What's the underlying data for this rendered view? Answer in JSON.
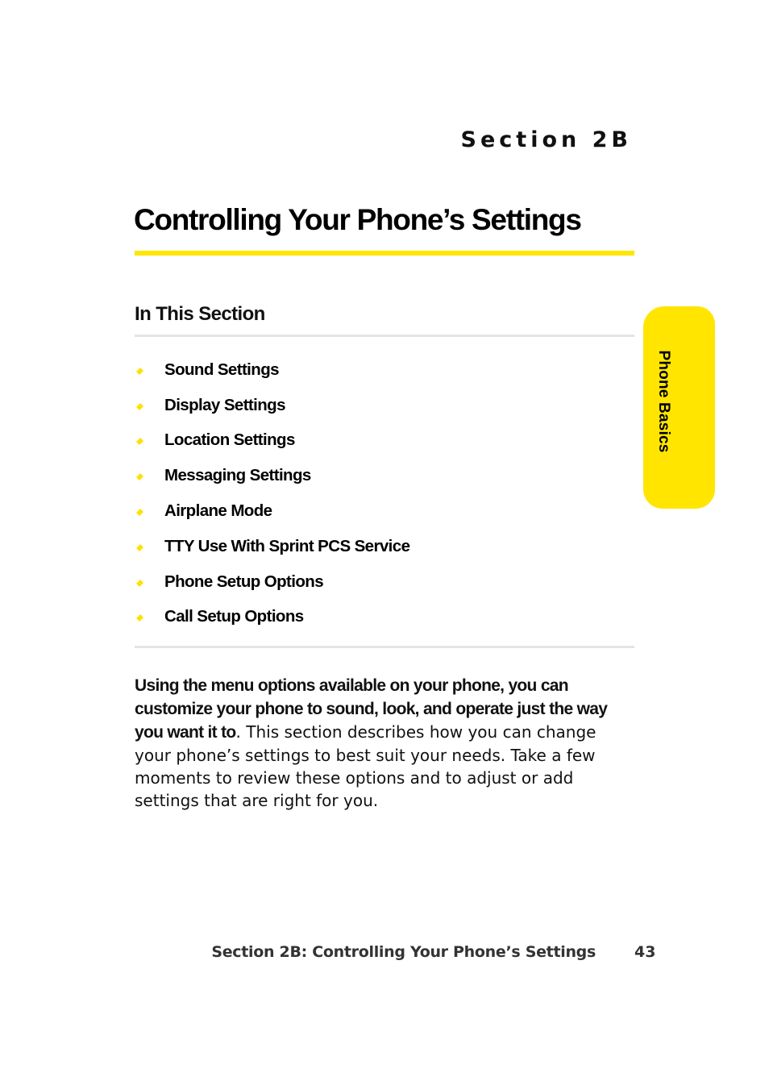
{
  "header": {
    "section_label": "Section 2B",
    "title": "Controlling Your Phone’s Settings"
  },
  "in_this_section": {
    "heading": "In This Section",
    "bullet_icon": "yellow-diamond-bullet",
    "items": [
      {
        "label": "Sound Settings"
      },
      {
        "label": "Display Settings"
      },
      {
        "label": "Location Settings"
      },
      {
        "label": "Messaging Settings"
      },
      {
        "label": "Airplane Mode"
      },
      {
        "label": "TTY Use With Sprint PCS Service"
      },
      {
        "label": "Phone Setup Options"
      },
      {
        "label": "Call Setup Options"
      }
    ]
  },
  "intro": {
    "bold_text": "Using the menu options available on your phone, you can customize your phone to sound, look, and operate just the way you want it to",
    "regular_text": ". This section describes how you can change your phone’s settings to best suit your needs. Take a few moments to review these options and to adjust or add settings that are right for you."
  },
  "side_tab": {
    "label": "Phone Basics"
  },
  "footer": {
    "running_title": "Section 2B: Controlling Your Phone’s Settings",
    "page_number": "43"
  },
  "colors": {
    "accent_yellow": "#ffe500",
    "rule_gray": "#e4e4e4",
    "footer_text": "#333333"
  }
}
